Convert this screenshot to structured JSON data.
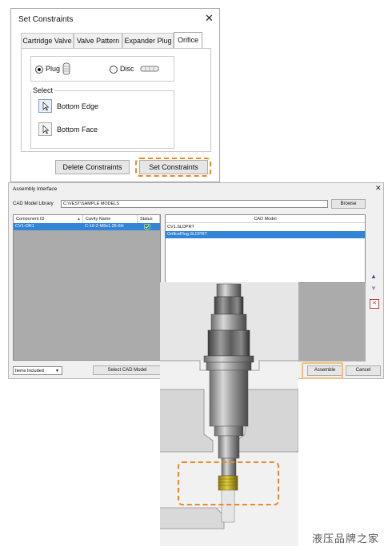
{
  "set_constraints": {
    "title": "Set Constraints",
    "close": "✕",
    "tabs": [
      "Cartridge Valve",
      "Valve Pattern",
      "Expander Plug",
      "Orifice"
    ],
    "active_tab": "Orifice",
    "type_options": [
      {
        "label": "Plug",
        "selected": true
      },
      {
        "label": "Disc",
        "selected": false
      }
    ],
    "select_group_label": "Select",
    "select_items": [
      "Bottom Edge",
      "Bottom Face"
    ],
    "delete_button": "Delete Constraints",
    "set_button": "Set Constraints"
  },
  "assembly_interface": {
    "title": "Assembly Interface",
    "close": "✕",
    "library_label": "CAD Model Library",
    "library_path": "C:\\VEST\\SAMPLE MODELS",
    "browse_button": "Browse",
    "columns": [
      "Component ID",
      "Cavity Name",
      "Status"
    ],
    "components": [
      {
        "id": "CV1-OR1",
        "cavity": "C-10-2-M8x1.25-6H",
        "status": "ok"
      }
    ],
    "cad_header": "CAD Model",
    "cad_models": [
      {
        "name": "CV1.SLDPRT",
        "selected": false
      },
      {
        "name": "OrificePlug.SLDPRT",
        "selected": true
      }
    ],
    "filter_value": "Items Included",
    "select_cad_button": "Select CAD Model",
    "assemble_button": "Assemble",
    "cancel_button": "Cancel"
  },
  "colors": {
    "highlight": "#e8892b",
    "selection": "#3284d6",
    "list_bg": "#ababab"
  },
  "watermark": "液压品牌之家"
}
